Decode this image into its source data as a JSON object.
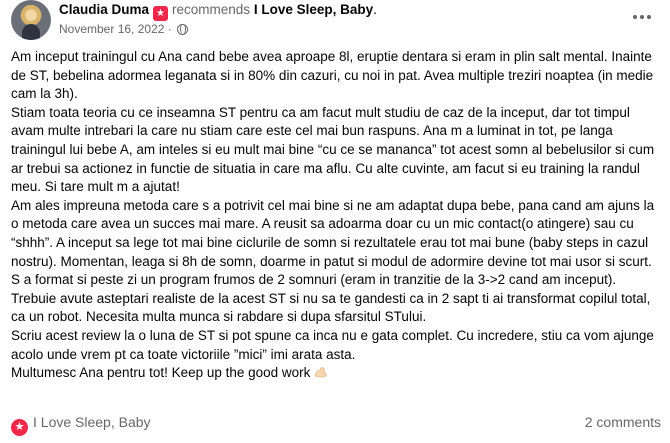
{
  "post": {
    "author": "Claudia Duma",
    "action": "recommends",
    "page": "I Love Sleep, Baby",
    "period": ".",
    "date": "November 16, 2022",
    "separator": "·",
    "paragraphs": [
      "Am inceput trainingul cu Ana cand bebe avea aproape 8l, eruptie dentara si eram in plin salt mental. Inainte de ST, bebelina adormea leganata si in 80% din cazuri, cu noi in pat. Avea multiple treziri noaptea (in medie cam la 3h).",
      "Stiam toata teoria cu ce inseamna ST pentru ca am facut mult studiu de caz de la inceput, dar tot timpul avam multe intrebari la care nu stiam care este cel mai bun raspuns. Ana m a luminat in tot, pe langa trainingul lui bebe A, am inteles si eu mult mai bine “cu ce se mananca” tot acest somn al bebelusilor si cum ar trebui sa actionez in functie de situatia in care ma aflu. Cu alte cuvinte, am facut si eu training la randul meu. Si tare mult m a ajutat!",
      "Am ales impreuna metoda care s a potrivit cel mai bine si ne am adaptat dupa bebe, pana cand am ajuns la o metoda care avea un succes mai mare. A reusit sa adoarma doar cu un mic contact(o atingere) sau cu “shhh”. A inceput sa lege tot mai bine ciclurile de somn si rezultatele erau tot mai bune (baby steps in cazul nostru). Momentan, leaga si 8h de somn, doarme in patut si modul de adormire devine tot mai usor si scurt. S a format si peste zi un program frumos de 2 somnuri (eram in tranzitie de la 3->2 cand am inceput).",
      "Trebuie avute asteptari realiste de la acest ST si nu sa te gandesti ca in 2 sapt ti ai transformat copilul total, ca un robot. Necesita multa munca si rabdare si dupa sfarsitul STului.",
      "Scriu acest review la o luna de ST si pot spune ca inca nu e gata complet. Cu incredere, stiu ca vom ajunge acolo unde vrem pt ca toate victoriile ”mici” imi arata asta.",
      "Multumesc Ana pentru tot! Keep up the good work"
    ]
  },
  "footer": {
    "page_link": "I Love Sleep, Baby",
    "comments": "2 comments"
  },
  "icons": {
    "recommend_badge": "recommend-badge-icon",
    "privacy": "globe-icon",
    "more": "more-options-icon",
    "emoji": "flexed-biceps-emoji",
    "page_star": "star-badge-icon"
  },
  "colors": {
    "badge": "#f02849",
    "secondary_text": "#65676b",
    "primary_text": "#050505"
  }
}
